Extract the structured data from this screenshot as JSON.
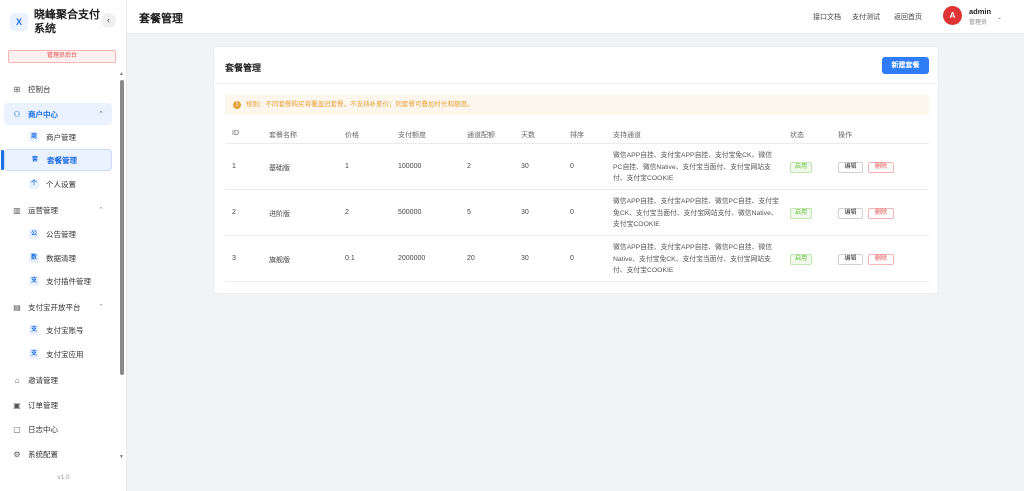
{
  "brand": {
    "logo_letter": "X",
    "name": "晓峰聚合支付系统",
    "collapse_icon": "chevron-left-icon"
  },
  "role_tag": "管理员后台",
  "sidebar": {
    "items": [
      {
        "label": "控制台",
        "icon": "grid-icon"
      },
      {
        "label": "商户中心",
        "icon": "user-icon",
        "expanded": true,
        "children": [
          {
            "label": "商户管理",
            "badge": "商"
          },
          {
            "label": "套餐管理",
            "badge": "套",
            "active": true
          },
          {
            "label": "个人设置",
            "badge": "个"
          }
        ]
      },
      {
        "label": "运营管理",
        "icon": "bar-chart-icon",
        "expanded": true,
        "children": [
          {
            "label": "公告管理",
            "badge": "公"
          },
          {
            "label": "数据清理",
            "badge": "数"
          },
          {
            "label": "支付插件管理",
            "badge": "支"
          }
        ]
      },
      {
        "label": "支付宝开放平台",
        "icon": "message-icon",
        "expanded": true,
        "children": [
          {
            "label": "支付宝账号",
            "badge": "支"
          },
          {
            "label": "支付宝应用",
            "badge": "支"
          }
        ]
      },
      {
        "label": "邀请管理",
        "icon": "home-icon"
      },
      {
        "label": "订单管理",
        "icon": "clipboard-icon"
      },
      {
        "label": "日志中心",
        "icon": "document-icon"
      },
      {
        "label": "系统配置",
        "icon": "gear-icon"
      }
    ]
  },
  "version": "v1.0",
  "header": {
    "title": "套餐管理",
    "links": [
      "接口文档",
      "支付测试",
      "返回首页"
    ],
    "user": {
      "avatar_letter": "A",
      "name": "admin",
      "role": "管理员"
    }
  },
  "card": {
    "title": "套餐管理",
    "new_button": "新建套餐",
    "notice": "规则：不同套餐购买将覆盖旧套餐，不支持补差价；同套餐可叠加时长和额度。"
  },
  "table": {
    "columns": [
      "ID",
      "套餐名称",
      "价格",
      "支付额度",
      "通道配额",
      "天数",
      "排序",
      "支持通道",
      "状态",
      "操作"
    ],
    "rows": [
      {
        "id": "1",
        "name": "基础版",
        "price": "1",
        "quota": "100000",
        "channels": "2",
        "days": "30",
        "sort": "0",
        "supported": "微信APP自挂、支付宝APP自挂、支付宝免CK、微信PC自挂、微信Native、支付宝当面付、支付宝网站支付、支付宝COOKIE",
        "status": "启用",
        "edit": "编辑",
        "delete": "删除"
      },
      {
        "id": "2",
        "name": "进阶版",
        "price": "2",
        "quota": "500000",
        "channels": "5",
        "days": "30",
        "sort": "0",
        "supported": "微信APP自挂、支付宝APP自挂、微信PC自挂、支付宝免CK、支付宝当面付、支付宝网站支付、微信Native、支付宝COOKIE",
        "status": "启用",
        "edit": "编辑",
        "delete": "删除"
      },
      {
        "id": "3",
        "name": "旗舰版",
        "price": "0.1",
        "quota": "2000000",
        "channels": "20",
        "days": "30",
        "sort": "0",
        "supported": "微信APP自挂、支付宝APP自挂、微信PC自挂、微信Native、支付宝免CK、支付宝当面付、支付宝网站支付、支付宝COOKIE",
        "status": "启用",
        "edit": "编辑",
        "delete": "删除"
      }
    ]
  },
  "colors": {
    "accent": "#2e7cf6",
    "danger": "#e14a4a",
    "success": "#67c23a",
    "warning": "#e6a23c"
  }
}
